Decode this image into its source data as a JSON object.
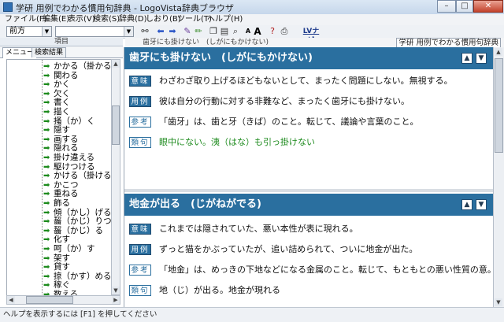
{
  "window": {
    "title": "学研 用例でわかる慣用句辞典 - LogoVista辞典ブラウザ",
    "minimize": "–",
    "maximize": "□",
    "close": "✕"
  },
  "menubar": [
    "ファイル(F)",
    "編集(E)",
    "表示(V)",
    "検索(S)",
    "辞典(D)",
    "しおり(B)",
    "ツール(T)",
    "ヘルプ(H)"
  ],
  "toolbar": {
    "search_mode": "前方",
    "search_value": "",
    "icons": [
      "binoculars-icon",
      "arrow-left-icon",
      "arrow-right-icon",
      "pencil-icon",
      "highlighter-icon",
      "copy-icon",
      "paste-icon",
      "zoom-icon",
      "font-small-icon",
      "font-large-icon",
      "help-icon",
      "print-icon",
      "lv-navi-icon"
    ],
    "font_small": "A",
    "font_large": "A",
    "lv_navi": "LVナビ"
  },
  "left": {
    "header": "項目",
    "tabs": [
      "メニュー",
      "検索結果"
    ],
    "items": [
      "かかる（掛かる）",
      "関わる",
      "かく",
      "欠く",
      "書く",
      "描く",
      "掻（か）く",
      "隠す",
      "画する",
      "隠れる",
      "掛け違える",
      "駆けつける",
      "かける（掛ける）",
      "かこつ",
      "重ねる",
      "飾る",
      "傾（かし）げる",
      "齧（かじ）りつく",
      "齧（かじ）る",
      "化す",
      "呵（か）す",
      "架す",
      "貸す",
      "掠（かす）める",
      "稼ぐ",
      "数える"
    ]
  },
  "right": {
    "breadcrumb": "歯牙にも掛けない　(しがにもかけない)",
    "source": "学研 用例でわかる慣用句辞典",
    "entries": [
      {
        "title": "歯牙にも掛けない　(しがにもかけない)",
        "rows": [
          {
            "label": "意味",
            "style": "filled",
            "text": "わざわざ取り上げるほどもないとして、まったく問題にしない。無視する。"
          },
          {
            "label": "用例",
            "style": "filled",
            "text": "彼は自分の行動に対する非難など、まったく歯牙にも掛けない。"
          },
          {
            "label": "参考",
            "style": "outline",
            "text": "「歯牙」は、歯と牙（きば）のこと。転じて、議論や言葉のこと。"
          },
          {
            "label": "類句",
            "style": "outline",
            "text": "眼中にない。洟（はな）も引っ掛けない",
            "green": true
          }
        ]
      },
      {
        "title": "地金が出る　(じがねがでる)",
        "rows": [
          {
            "label": "意味",
            "style": "filled",
            "text": "これまでは隠されていた、悪い本性が表に現れる。"
          },
          {
            "label": "用例",
            "style": "filled",
            "text": "ずっと猫をかぶっていたが、追い詰められて、ついに地金が出た。"
          },
          {
            "label": "参考",
            "style": "outline",
            "text": "「地金」は、めっきの下地などになる金属のこと。転じて、もともとの悪い性質の意。"
          },
          {
            "label": "類句",
            "style": "outline",
            "text": "地（じ）が出る。地金が現れる"
          }
        ]
      }
    ]
  },
  "status": "ヘルプを表示するには [F1] を押してください"
}
